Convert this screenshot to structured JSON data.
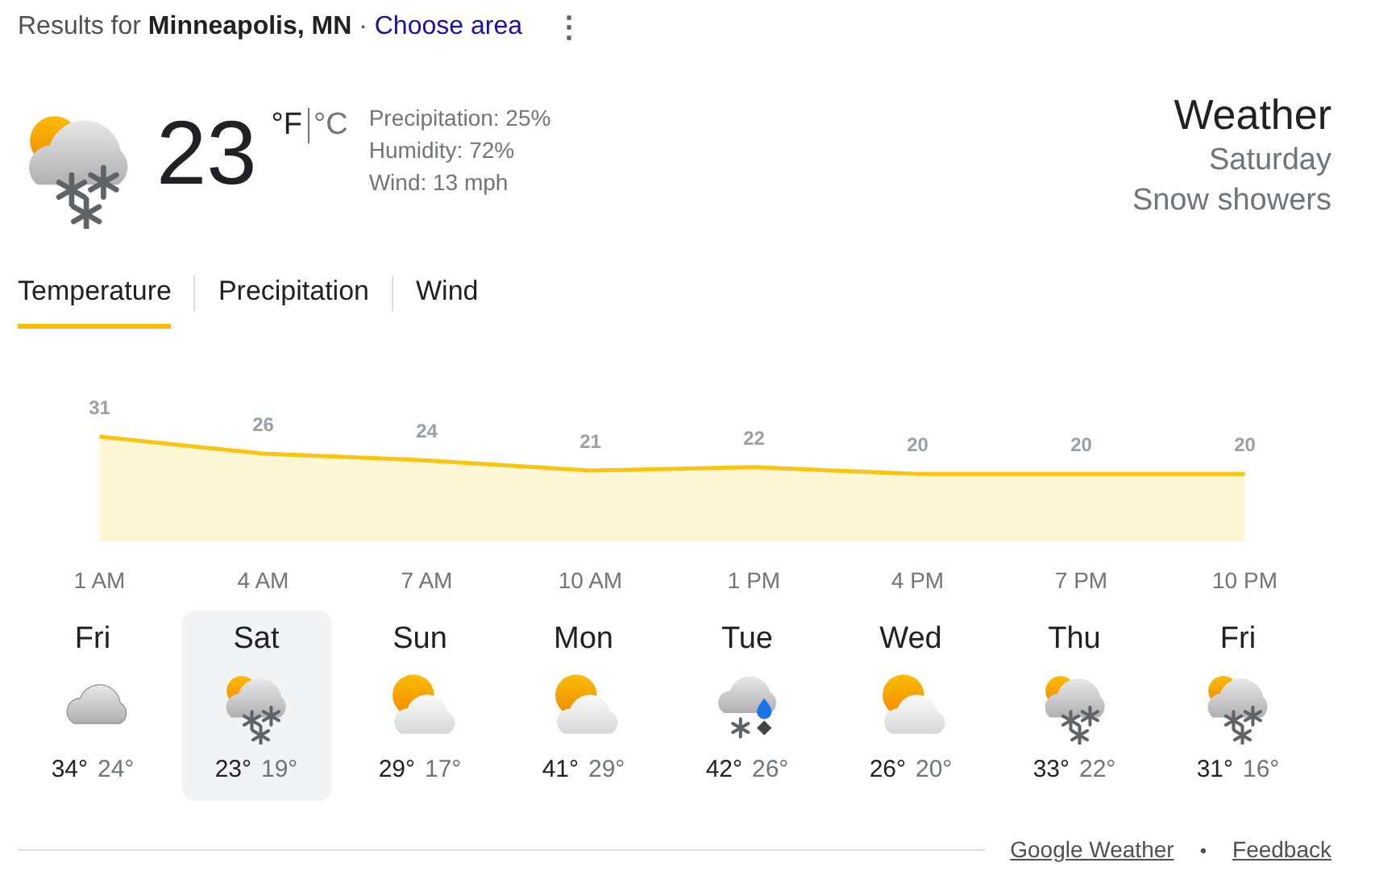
{
  "location": {
    "prefix": "Results for",
    "place": "Minneapolis, MN",
    "separator": "·",
    "link": "Choose area",
    "menu": "⋮"
  },
  "current": {
    "kind": "snow-partly",
    "temperature": "23",
    "units": [
      {
        "label": "°F",
        "selected": true
      },
      {
        "label": "°C",
        "selected": false
      }
    ],
    "details": [
      "Precipitation: 25%",
      "Humidity: 72%",
      "Wind: 13 mph"
    ],
    "heading": "Weather",
    "day": "Saturday",
    "condition": "Snow showers"
  },
  "tabs": [
    {
      "label": "Temperature",
      "selected": true
    },
    {
      "label": "Precipitation",
      "selected": false
    },
    {
      "label": "Wind",
      "selected": false
    }
  ],
  "chart": {
    "chart_data": {
      "type": "area",
      "categories": [
        "1 AM",
        "4 AM",
        "7 AM",
        "10 AM",
        "1 PM",
        "4 PM",
        "7 PM",
        "10 PM"
      ],
      "values": [
        31,
        26,
        24,
        21,
        22,
        20,
        20,
        20
      ],
      "data_labels": true
    }
  },
  "days": [
    {
      "day": "Fri",
      "kind": "cloudy",
      "high": "34°",
      "low": "24°",
      "selected": false
    },
    {
      "day": "Sat",
      "kind": "snow-partly",
      "high": "23°",
      "low": "19°",
      "selected": true
    },
    {
      "day": "Sun",
      "kind": "sun-cloud",
      "high": "29°",
      "low": "17°",
      "selected": false
    },
    {
      "day": "Mon",
      "kind": "sun-cloud",
      "high": "41°",
      "low": "29°",
      "selected": false
    },
    {
      "day": "Tue",
      "kind": "rain-snow",
      "high": "42°",
      "low": "26°",
      "selected": false
    },
    {
      "day": "Wed",
      "kind": "sun-cloud",
      "high": "26°",
      "low": "20°",
      "selected": false
    },
    {
      "day": "Thu",
      "kind": "snow-partly",
      "high": "33°",
      "low": "22°",
      "selected": false
    },
    {
      "day": "Fri",
      "kind": "snow-partly",
      "high": "31°",
      "low": "16°",
      "selected": false
    }
  ],
  "footer": {
    "links": [
      "Google Weather",
      "Feedback"
    ],
    "separator": "•"
  }
}
